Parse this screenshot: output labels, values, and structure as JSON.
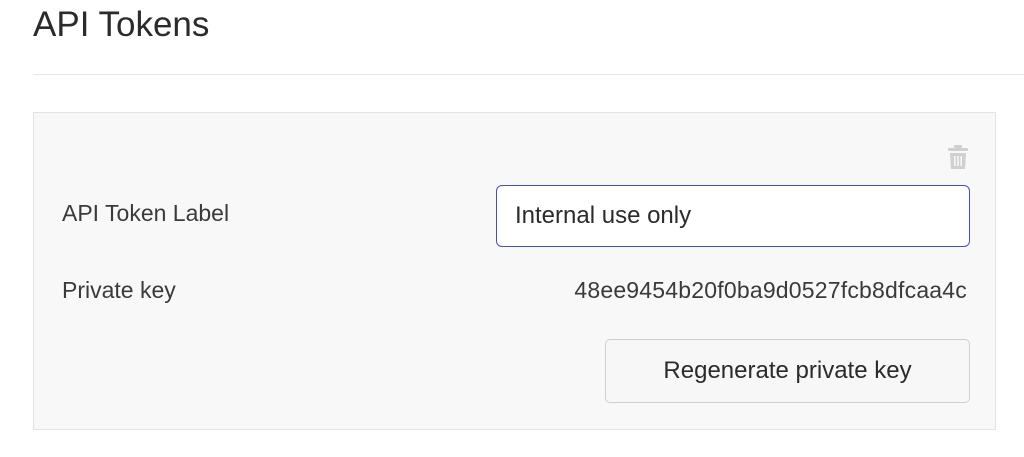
{
  "page": {
    "title": "API Tokens"
  },
  "token": {
    "label_caption": "API Token Label",
    "label_value": "Internal use only",
    "private_key_caption": "Private key",
    "private_key_value": "48ee9454b20f0ba9d0527fcb8dfcaa4c",
    "regenerate_label": "Regenerate private key",
    "delete_icon": "trash-icon"
  },
  "colors": {
    "input_focus_border": "#4a4fb0",
    "card_background": "#f8f8f8",
    "icon_gray": "#cfcfcf"
  }
}
